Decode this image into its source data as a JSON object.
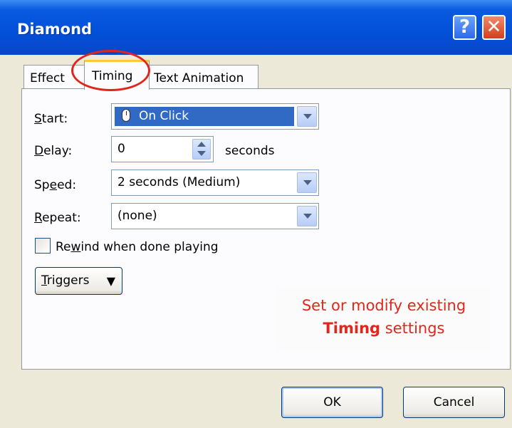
{
  "window": {
    "title": "Diamond",
    "help_label": "?",
    "close_label": "✕"
  },
  "tabs": [
    {
      "label": "Effect",
      "active": false
    },
    {
      "label": "Timing",
      "active": true
    },
    {
      "label": "Text Animation",
      "active": false
    }
  ],
  "form": {
    "start": {
      "label_pre": "",
      "label_u": "S",
      "label_post": "tart:",
      "value": "On Click",
      "icon": "mouse-icon"
    },
    "delay": {
      "label_pre": "",
      "label_u": "D",
      "label_post": "elay:",
      "value": "0",
      "unit": "seconds"
    },
    "speed": {
      "label_pre": "Sp",
      "label_u": "e",
      "label_post": "ed:",
      "value": "2 seconds (Medium)"
    },
    "repeat": {
      "label_pre": "",
      "label_u": "R",
      "label_post": "epeat:",
      "value": "(none)"
    },
    "rewind": {
      "label_pre": "Re",
      "label_u": "w",
      "label_post": "ind when done playing",
      "checked": false
    }
  },
  "triggers": {
    "label_u": "T",
    "label_post": "riggers",
    "icon": "double-chevron-down-icon",
    "glyph": "▼"
  },
  "annotation": {
    "line1": "Set or modify existing",
    "bold": "Timing",
    "line2_rest": " settings"
  },
  "buttons": {
    "ok": "OK",
    "cancel": "Cancel"
  },
  "colors": {
    "titlebar": "#0250d8",
    "highlight": "#e0261c",
    "selection": "#316ac5"
  }
}
